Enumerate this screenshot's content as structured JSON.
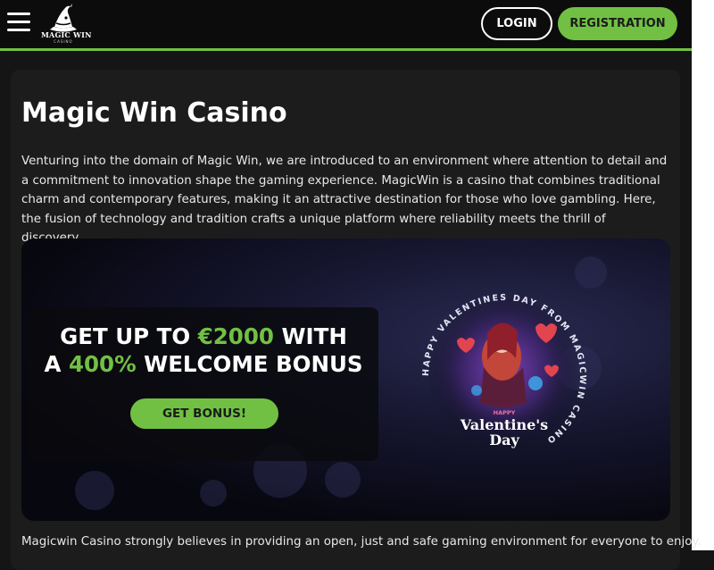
{
  "header": {
    "menu_icon": "hamburger-menu-icon",
    "logo": {
      "name": "MAGIC WIN",
      "sub": "CASINO"
    },
    "login_label": "LOGIN",
    "registration_label": "REGISTRATION"
  },
  "main": {
    "title": "Magic Win Casino",
    "intro": "Venturing into the domain of Magic Win, we are introduced to an environment where attention to detail and a commitment to innovation shape the gaming experience. MagicWin is a casino that combines traditional charm and contemporary features, making it an attractive destination for those who love gambling. Here, the fusion of technology and tradition crafts a unique platform where reliability meets the thrill of discovery.",
    "banner": {
      "line1_pre": "GET UP TO ",
      "line1_highlight": "€2000",
      "line1_post": " WITH",
      "line2_pre": "A ",
      "line2_highlight": "400%",
      "line2_post": " WELCOME BONUS",
      "cta": "GET BONUS!",
      "badge_ring_text": "HAPPY VALENTINES DAY FROM MAGICWIN CASINO",
      "badge_happy": "HAPPY",
      "badge_title_1": "Valentine's",
      "badge_title_2": "Day"
    },
    "bottom_text": "Magicwin Casino strongly believes in providing an open, just and safe gaming environment for everyone to enjoy."
  },
  "colors": {
    "accent": "#71c043",
    "background": "#151515",
    "card": "#1c1c1c",
    "header": "#0c0c0c"
  }
}
